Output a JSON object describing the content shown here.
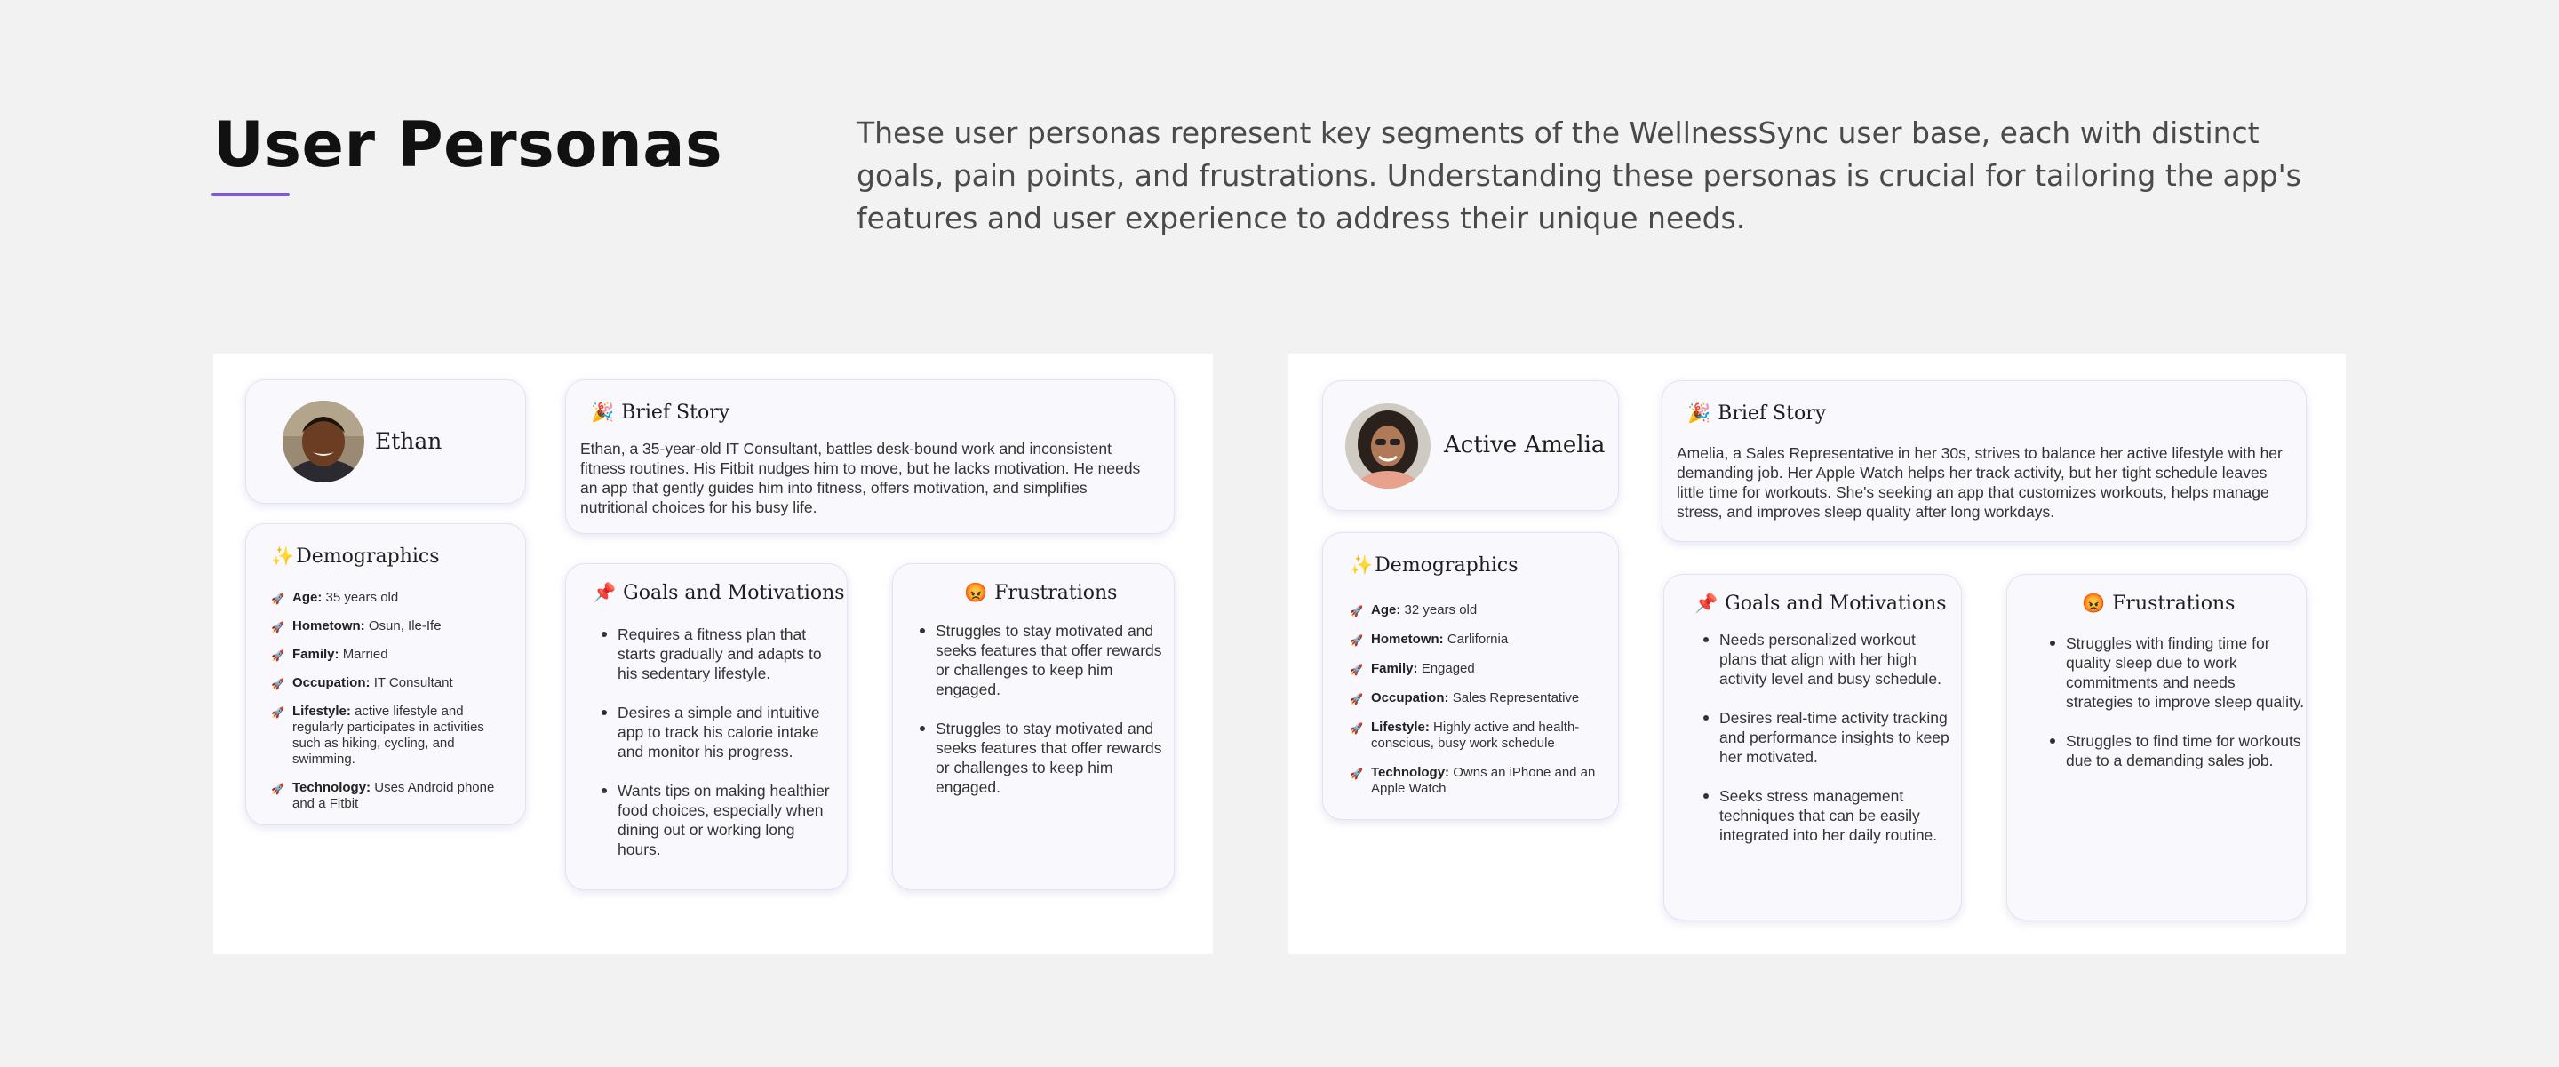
{
  "header": {
    "title": "User Personas",
    "description": "These user personas represent key segments of the WellnessSync user base, each with distinct goals, pain points, and frustrations. Understanding these personas is crucial for tailoring the app's features and user experience to address their unique needs."
  },
  "personas": [
    {
      "name": "Ethan",
      "brief_story_title": "Brief Story",
      "brief_story": "Ethan, a 35-year-old IT Consultant, battles desk-bound work and inconsistent fitness routines. His Fitbit nudges him to move, but he lacks motivation. He needs an app that gently guides him into fitness, offers motivation, and simplifies nutritional choices for his busy life.",
      "demographics_title": "Demographics",
      "demographics": [
        {
          "label": "Age:",
          "value": "35 years old"
        },
        {
          "label": "Hometown:",
          "value": "Osun, Ile-Ife"
        },
        {
          "label": "Family:",
          "value": "Married"
        },
        {
          "label": "Occupation:",
          "value": "IT Consultant"
        },
        {
          "label": "Lifestyle:",
          "value": " active lifestyle and regularly participates in activities such as hiking, cycling, and swimming."
        },
        {
          "label": "Technology:",
          "value": "Uses Android phone and a Fitbit"
        }
      ],
      "goals_title": "Goals and Motivations",
      "goals": [
        "Requires a fitness plan that starts gradually and adapts to his sedentary lifestyle.",
        "Desires a simple and intuitive app to track his calorie intake and monitor his progress.",
        "Wants tips on making healthier food choices, especially when dining out or working long hours."
      ],
      "frustrations_title": "Frustrations",
      "frustrations": [
        "Struggles to stay motivated and seeks features that offer rewards or challenges to keep him engaged.",
        "Struggles to stay motivated and seeks features that offer rewards or challenges to keep him engaged."
      ]
    },
    {
      "name": "Active Amelia",
      "brief_story_title": "Brief Story",
      "brief_story": "Amelia, a Sales Representative in her 30s, strives to balance her active lifestyle with her demanding job. Her Apple Watch helps her track activity, but her tight schedule leaves little time for workouts. She's seeking an app that customizes workouts, helps manage stress, and improves sleep quality after long workdays.",
      "demographics_title": "Demographics",
      "demographics": [
        {
          "label": "Age:",
          "value": "32 years old"
        },
        {
          "label": "Hometown:",
          "value": "Carlifornia"
        },
        {
          "label": "Family:",
          "value": "Engaged"
        },
        {
          "label": "Occupation:",
          "value": "Sales Representative"
        },
        {
          "label": "Lifestyle:",
          "value": " Highly active and health-conscious, busy work schedule"
        },
        {
          "label": "Technology:",
          "value": "Owns an iPhone and an Apple Watch"
        }
      ],
      "goals_title": "Goals and Motivations",
      "goals": [
        "Needs personalized workout plans that align with her high activity level and busy schedule.",
        "Desires real-time activity tracking and performance insights to keep her motivated.",
        "Seeks stress management techniques that can be easily integrated into her daily routine."
      ],
      "frustrations_title": "Frustrations",
      "frustrations": [
        "Struggles with finding time for quality sleep due to work commitments and needs strategies to improve sleep quality.",
        "Struggles to find time for workouts due to a demanding sales job."
      ]
    }
  ],
  "icons": {
    "brief_story": "party-popper-icon",
    "demographics": "sparkles-icon",
    "demographic_item": "rocket-icon",
    "goals": "pushpin-icon",
    "frustrations": "angry-face-icon"
  },
  "colors": {
    "accent": "#7a5ad8",
    "background": "#f2f2f2",
    "card": "#f8f8fd",
    "card_border": "#e1e2f2"
  }
}
